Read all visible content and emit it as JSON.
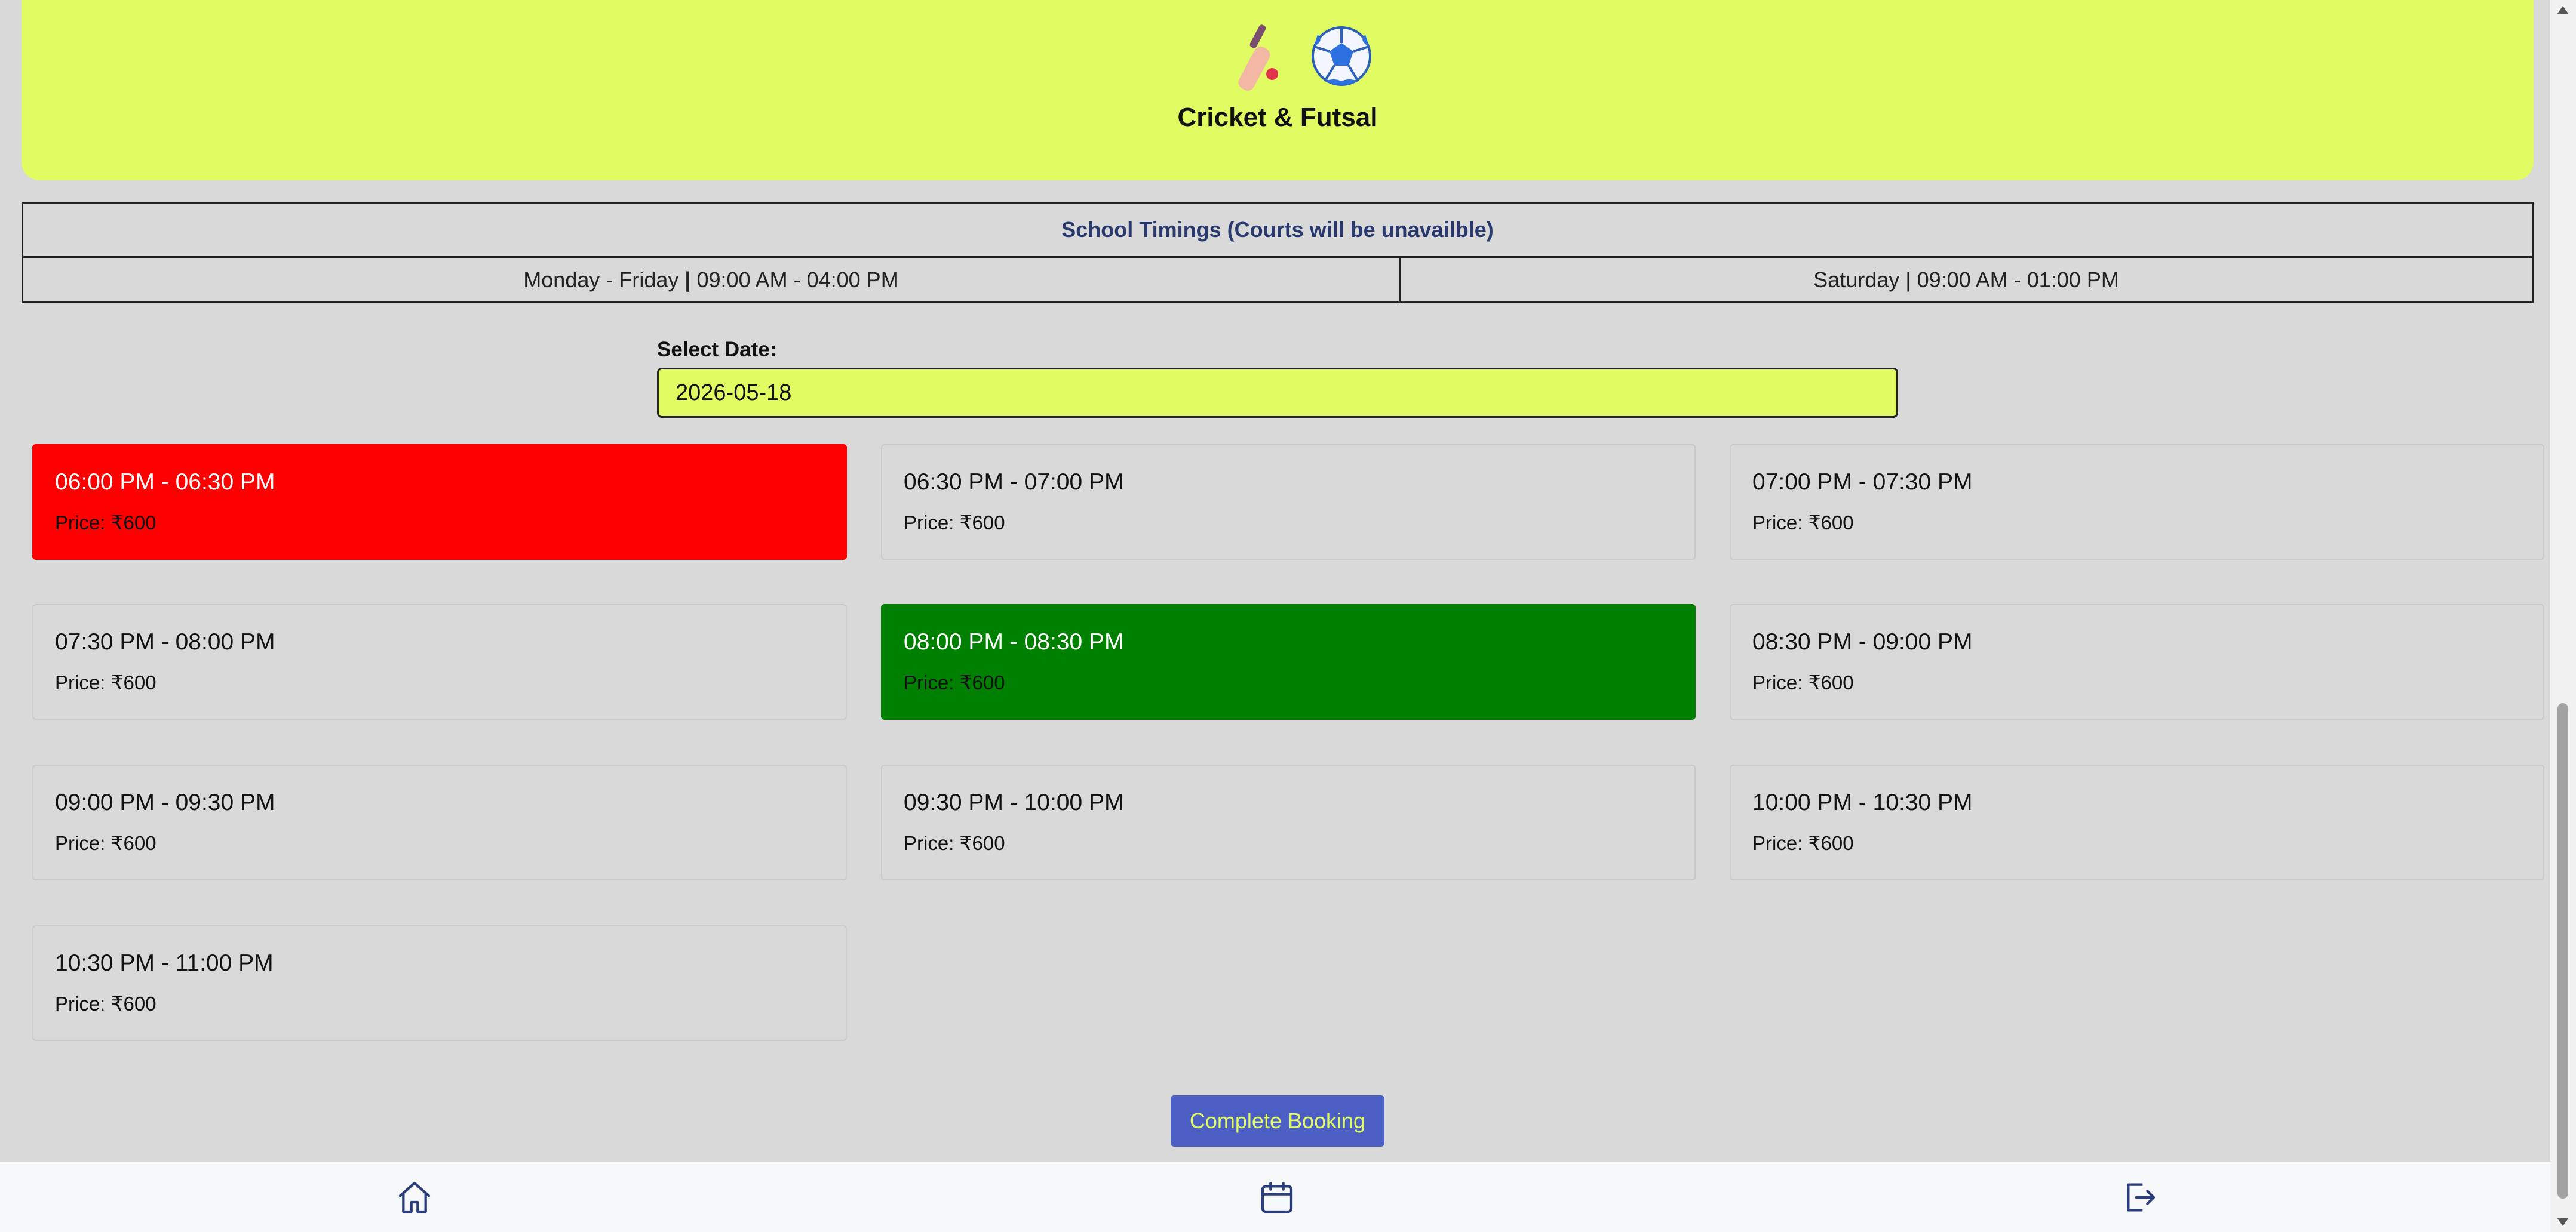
{
  "header": {
    "title": "Cricket & Futsal",
    "icons": [
      "cricket-bat-icon",
      "soccer-ball-icon"
    ],
    "background": "#e0fc62"
  },
  "timings": {
    "heading": "School Timings (Courts will be unavailble)",
    "weekday_days": "Monday - Friday",
    "weekday_hours": "09:00 AM - 04:00 PM",
    "saturday_days": "Saturday",
    "saturday_hours": "09:00 AM - 01:00 PM",
    "separator": "|"
  },
  "date": {
    "label": "Select Date:",
    "value": "2026-05-18"
  },
  "slots": [
    {
      "time": "06:00 PM - 06:30 PM",
      "price": "Price: ₹600",
      "status": "booked"
    },
    {
      "time": "06:30 PM - 07:00 PM",
      "price": "Price: ₹600",
      "status": "available"
    },
    {
      "time": "07:00 PM - 07:30 PM",
      "price": "Price: ₹600",
      "status": "available"
    },
    {
      "time": "07:30 PM - 08:00 PM",
      "price": "Price: ₹600",
      "status": "available"
    },
    {
      "time": "08:00 PM - 08:30 PM",
      "price": "Price: ₹600",
      "status": "selected"
    },
    {
      "time": "08:30 PM - 09:00 PM",
      "price": "Price: ₹600",
      "status": "available"
    },
    {
      "time": "09:00 PM - 09:30 PM",
      "price": "Price: ₹600",
      "status": "available"
    },
    {
      "time": "09:30 PM - 10:00 PM",
      "price": "Price: ₹600",
      "status": "available"
    },
    {
      "time": "10:00 PM - 10:30 PM",
      "price": "Price: ₹600",
      "status": "available"
    },
    {
      "time": "10:30 PM - 11:00 PM",
      "price": "Price: ₹600",
      "status": "available"
    }
  ],
  "status_colors": {
    "booked": "#ff0000",
    "selected": "#008000"
  },
  "actions": {
    "complete_booking": "Complete Booking",
    "button_color": "#4b5fc4"
  },
  "nav": {
    "items": [
      "home-icon",
      "calendar-icon",
      "logout-icon"
    ]
  }
}
